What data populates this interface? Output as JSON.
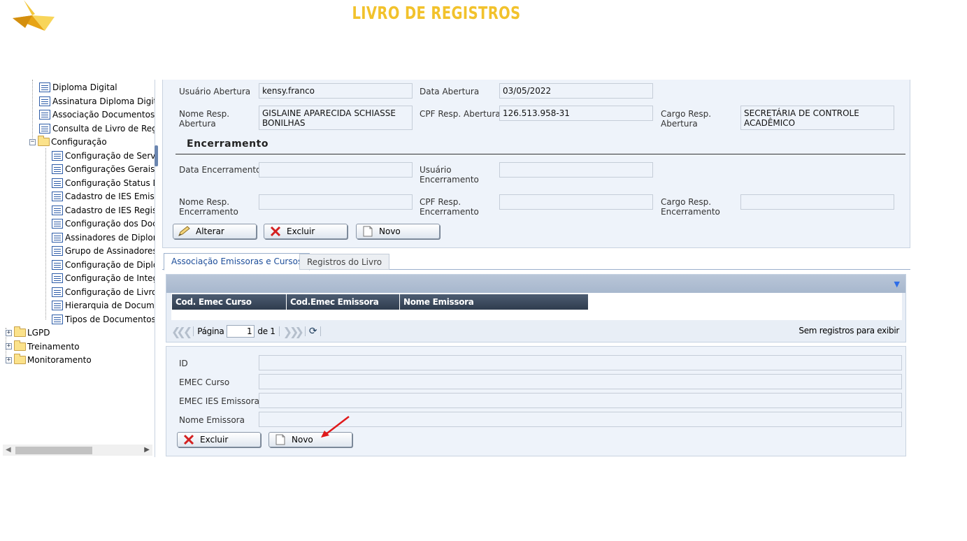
{
  "header": {
    "title": "LIVRO DE REGISTROS",
    "logo_icon": "paper-bird-logo"
  },
  "tree": {
    "items": [
      {
        "label": "Diploma Digital",
        "icon": "doc-icon"
      },
      {
        "label": "Assinatura Diploma Digital",
        "icon": "doc-icon"
      },
      {
        "label": "Associação Documentos Al",
        "icon": "doc-icon"
      },
      {
        "label": "Consulta de Livro de Regist",
        "icon": "doc-icon"
      },
      {
        "label": "Configuração",
        "icon": "folder-icon"
      },
      {
        "label": "Configuração de Serviço",
        "icon": "doc-icon"
      },
      {
        "label": "Configurações Gerais d",
        "icon": "doc-icon"
      },
      {
        "label": "Configuração Status Dip",
        "icon": "doc-icon"
      },
      {
        "label": "Cadastro de IES Emisso",
        "icon": "doc-icon"
      },
      {
        "label": "Cadastro de IES Registr",
        "icon": "doc-icon"
      },
      {
        "label": "Configuração dos Docur",
        "icon": "doc-icon"
      },
      {
        "label": "Assinadores de Diploma",
        "icon": "doc-icon"
      },
      {
        "label": "Grupo de Assinadores d",
        "icon": "doc-icon"
      },
      {
        "label": "Configuração de Diplom",
        "icon": "doc-icon"
      },
      {
        "label": "Configuração de Integra",
        "icon": "doc-icon"
      },
      {
        "label": "Configuração de Livro d",
        "icon": "doc-icon"
      },
      {
        "label": "Hierarquia de Document",
        "icon": "doc-icon"
      },
      {
        "label": "Tipos de Documentos d",
        "icon": "doc-icon"
      },
      {
        "label": "LGPD",
        "icon": "folder-icon"
      },
      {
        "label": "Treinamento",
        "icon": "folder-icon"
      },
      {
        "label": "Monitoramento",
        "icon": "folder-icon"
      }
    ]
  },
  "form": {
    "usuario_abertura_label": "Usuário Abertura",
    "usuario_abertura_value": "kensy.franco",
    "data_abertura_label": "Data Abertura",
    "data_abertura_value": "03/05/2022",
    "nome_resp_abertura_label_1": "Nome Resp.",
    "nome_resp_abertura_label_2": "Abertura",
    "nome_resp_abertura_value_1": "GISLAINE APARECIDA SCHIASSE",
    "nome_resp_abertura_value_2": "BONILHAS",
    "cpf_resp_abertura_label": "CPF Resp. Abertura",
    "cpf_resp_abertura_value": "126.513.958-31",
    "cargo_resp_abertura_label_1": "Cargo Resp.",
    "cargo_resp_abertura_label_2": "Abertura",
    "cargo_resp_abertura_value_1": "SECRETÁRIA DE CONTROLE",
    "cargo_resp_abertura_value_2": "ACADÊMICO",
    "encerramento_title": "Encerramento",
    "data_encerramento_label": "Data Encerramento",
    "data_encerramento_value": "",
    "usuario_encerramento_label_1": "Usuário",
    "usuario_encerramento_label_2": "Encerramento",
    "usuario_encerramento_value": "",
    "nome_resp_encerramento_label_1": "Nome Resp.",
    "nome_resp_encerramento_label_2": "Encerramento",
    "nome_resp_encerramento_value": "",
    "cpf_resp_encerramento_label_1": "CPF Resp.",
    "cpf_resp_encerramento_label_2": "Encerramento",
    "cpf_resp_encerramento_value": "",
    "cargo_resp_encerramento_label_1": "Cargo Resp.",
    "cargo_resp_encerramento_label_2": "Encerramento",
    "cargo_resp_encerramento_value": "",
    "buttons": {
      "alterar": "Alterar",
      "excluir": "Excluir",
      "novo": "Novo"
    }
  },
  "tabs": {
    "active": "Associação Emissoras e Cursos",
    "inactive": "Registros do Livro"
  },
  "grid": {
    "columns": [
      "Cod. Emec Curso",
      "Cod.Emec Emissora",
      "Nome Emissora"
    ],
    "rows": [],
    "pager": {
      "page_label": "Página",
      "page_value": "1",
      "of_label": "de 1",
      "empty_text": "Sem registros para exibir"
    }
  },
  "detail": {
    "id_label": "ID",
    "id_value": "",
    "emec_curso_label": "EMEC Curso",
    "emec_curso_value": "",
    "emec_ies_label": "EMEC IES Emissora",
    "emec_ies_value": "",
    "nome_emissora_label": "Nome Emissora",
    "nome_emissora_value": "",
    "buttons": {
      "excluir": "Excluir",
      "novo": "Novo"
    }
  },
  "colors": {
    "title": "#f2c22c",
    "panel_bg": "#eef3fa",
    "grid_header": "#3a4a5e",
    "annotation_arrow": "#e0191b"
  }
}
